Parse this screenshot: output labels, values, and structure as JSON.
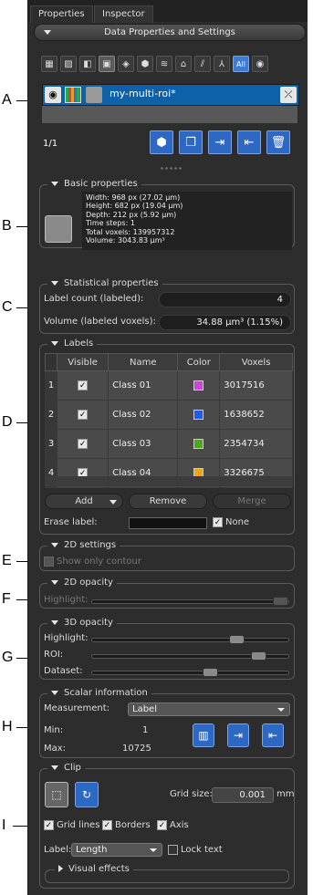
{
  "callouts": [
    "A",
    "B",
    "C",
    "D",
    "E",
    "F",
    "G",
    "H",
    "I"
  ],
  "tabs": [
    "Properties",
    "Inspector"
  ],
  "header": {
    "title": "Data Properties and Settings"
  },
  "toolbar": {
    "icons": [
      "table-icon",
      "no-data-icon",
      "square-icon",
      "multi-roi-icon",
      "diamond-icon",
      "mesh-icon",
      "layers-icon",
      "graph-icon",
      "lines-icon",
      "tree-icon"
    ],
    "all_label": "All",
    "eye_icon": "eye-icon"
  },
  "roi": {
    "name": "my-multi-roi*",
    "page_info": "1/1"
  },
  "basic": {
    "title": "Basic properties",
    "lines": [
      "Width: 968 px (27.02 µm)",
      "Height: 682 px (19.04 µm)",
      "Depth: 212 px (5.92 µm)",
      "Time steps: 1",
      "Total voxels: 139957312",
      "Volume: 3043.83 µm³"
    ]
  },
  "statistical": {
    "title": "Statistical properties",
    "label_count_label": "Label count (labeled):",
    "label_count_value": "4",
    "volume_label": "Volume (labeled voxels):",
    "volume_value": "34.88 µm³ (1.15%)"
  },
  "labels": {
    "title": "Labels",
    "columns": [
      "Visible",
      "Name",
      "Color",
      "Voxels"
    ],
    "rows": [
      {
        "n": "1",
        "visible": "✓",
        "name": "Class 01",
        "color": "#cc44dd",
        "voxels": "3017516"
      },
      {
        "n": "2",
        "visible": "✓",
        "name": "Class 02",
        "color": "#1a5ef0",
        "voxels": "1638652"
      },
      {
        "n": "3",
        "visible": "✓",
        "name": "Class 03",
        "color": "#4aaa16",
        "voxels": "2354734"
      },
      {
        "n": "4",
        "visible": "✓",
        "name": "Class 04",
        "color": "#f5a40e",
        "voxels": "3326675"
      }
    ],
    "add": "Add",
    "remove": "Remove",
    "merge": "Merge",
    "erase_label": "Erase label:",
    "none_label": "None"
  },
  "settings_2d": {
    "title": "2D settings",
    "show_only_contour": "Show only contour"
  },
  "opacity_2d": {
    "title": "2D opacity",
    "highlight": "Highlight:",
    "highlight_value": 1.0
  },
  "opacity_3d": {
    "title": "3D opacity",
    "highlight": "Highlight:",
    "highlight_value": 0.76,
    "roi": "ROI:",
    "roi_value": 0.88,
    "dataset": "Dataset:",
    "dataset_value": 0.61
  },
  "scalar": {
    "title": "Scalar information",
    "measurement_label": "Measurement:",
    "measurement_value": "Label",
    "min_label": "Min:",
    "min_value": "1",
    "max_label": "Max:",
    "max_value": "10725"
  },
  "clip": {
    "title": "Clip",
    "grid_size_label": "Grid size:",
    "grid_size_value": "0.001",
    "grid_size_unit": "mm",
    "grid_lines": "Grid lines",
    "borders": "Borders",
    "axis": "Axis",
    "label_label": "Label:",
    "label_value": "Length",
    "lock_text": "Lock text",
    "visual_effects": "Visual effects"
  },
  "colors": {
    "accent": "#2d68c4",
    "selection": "#0d61a8",
    "panel": "#2d2d2d"
  }
}
